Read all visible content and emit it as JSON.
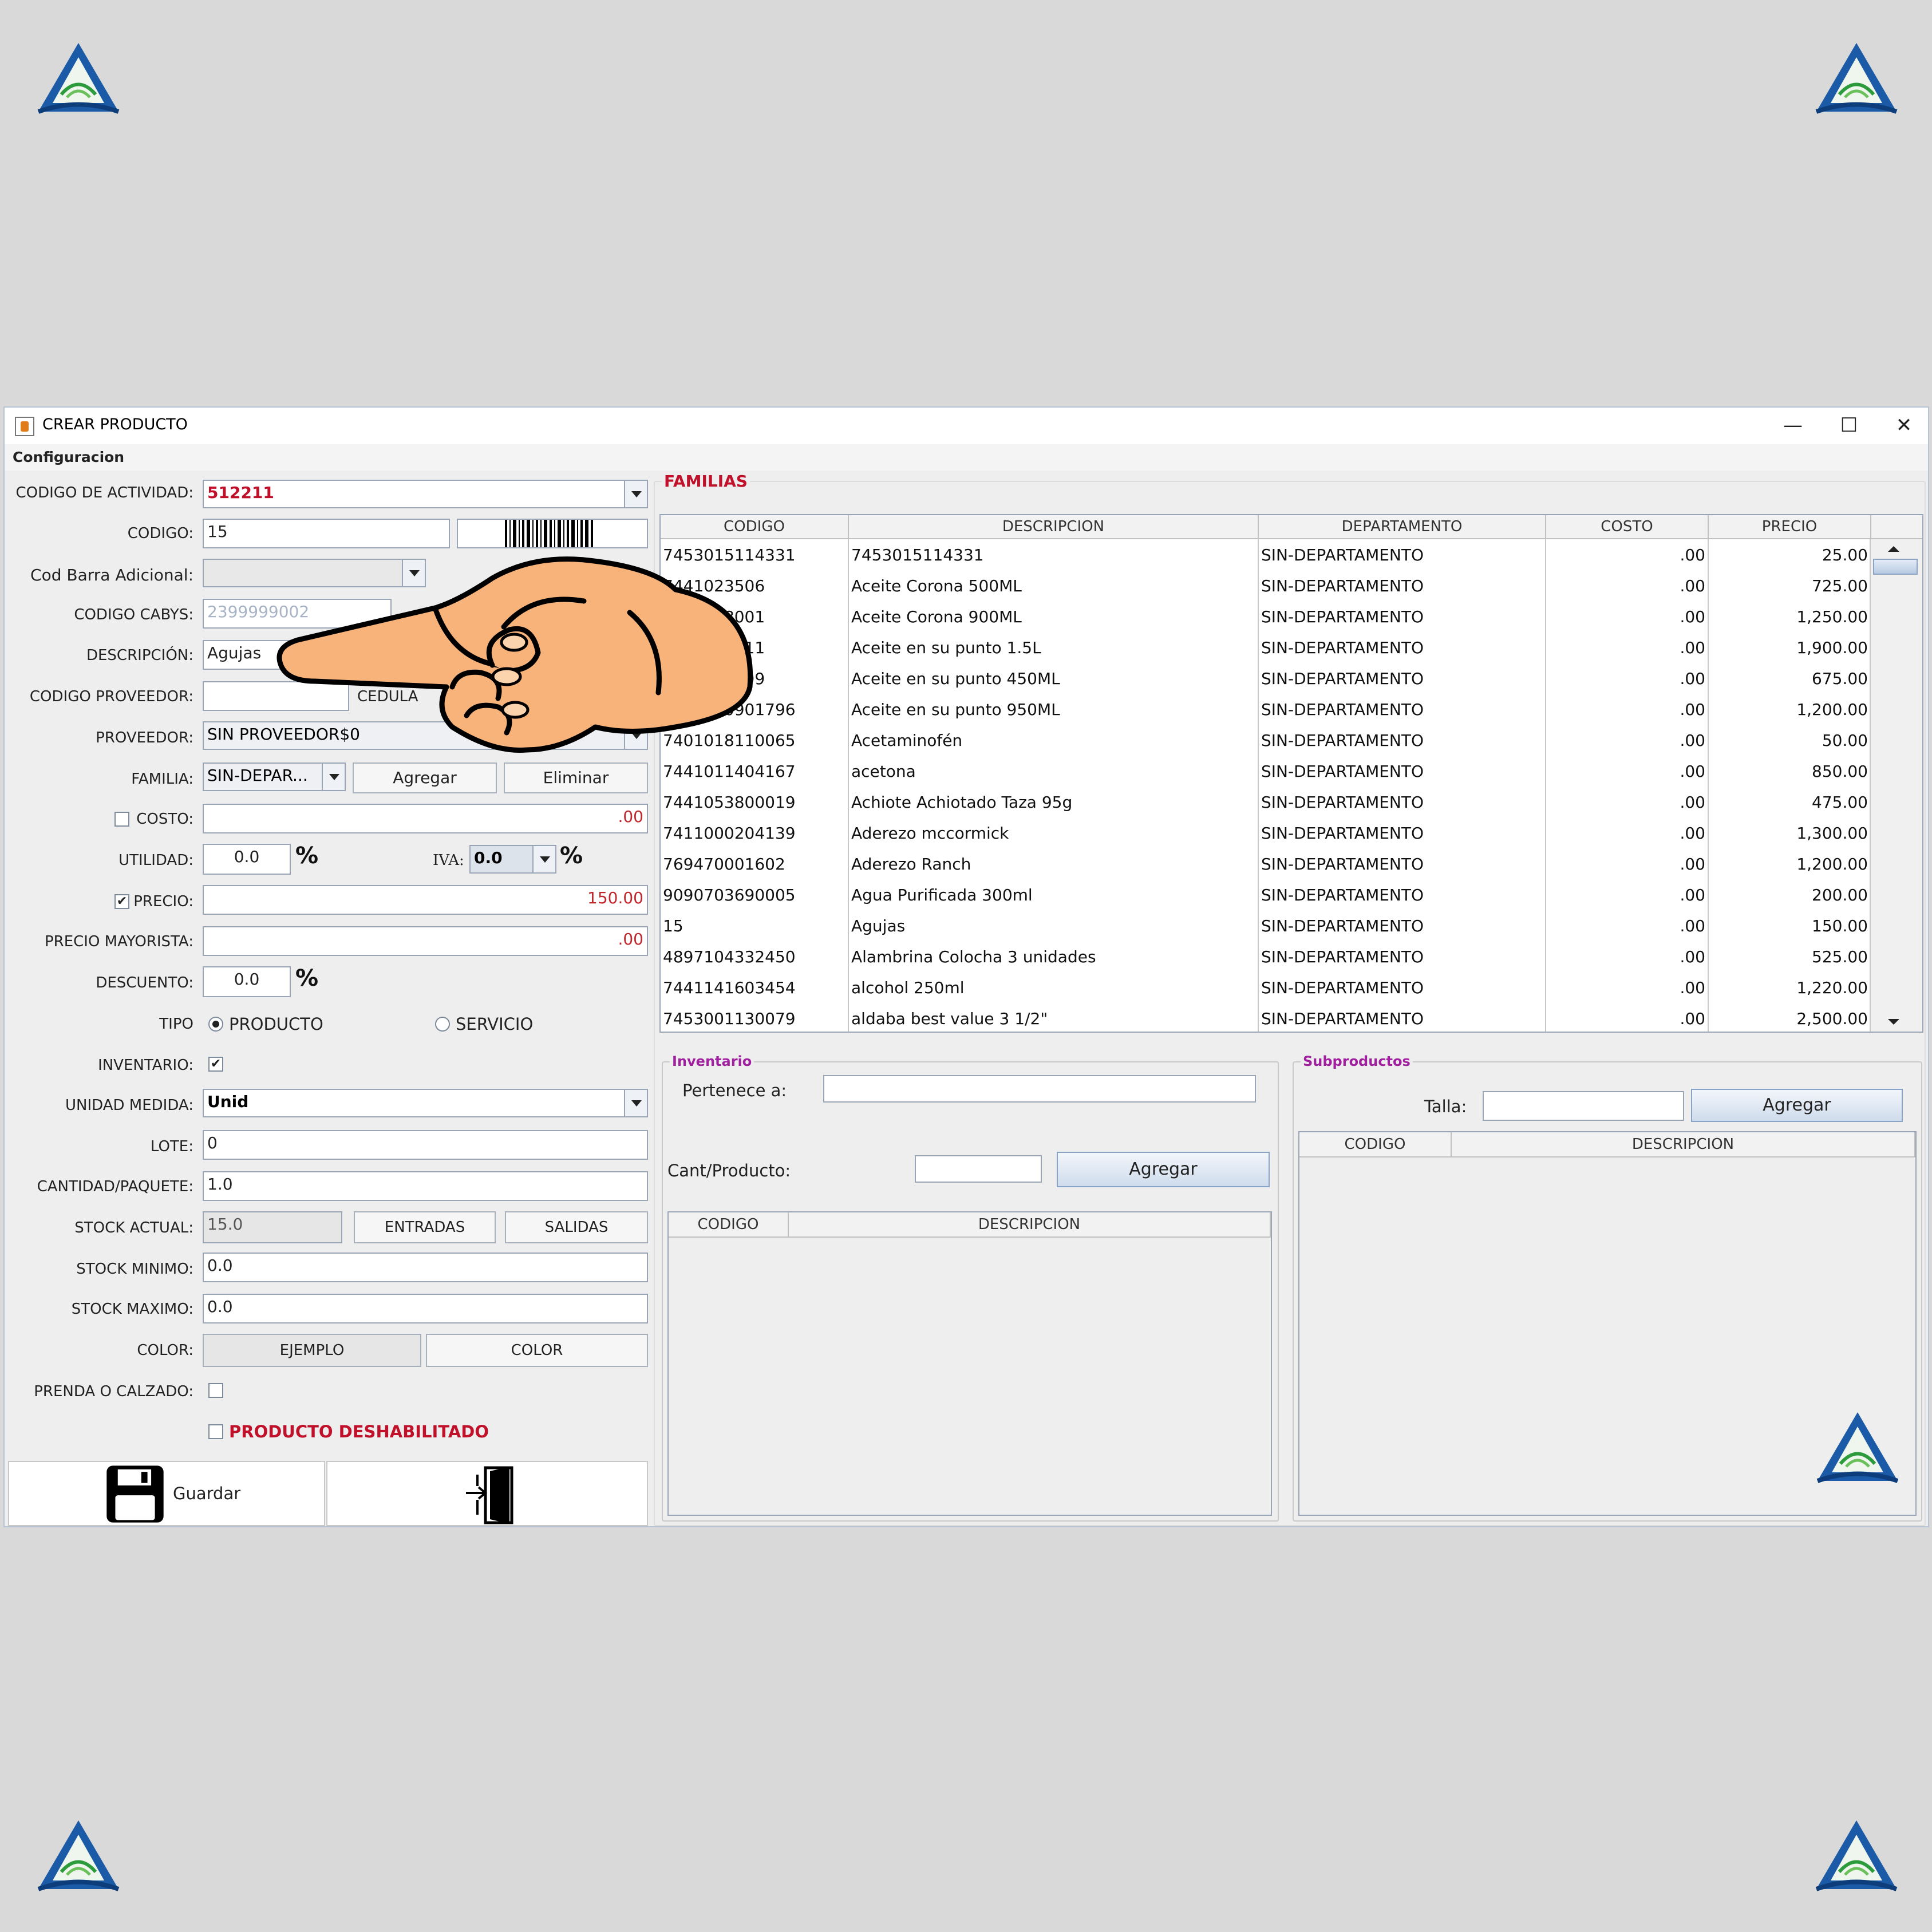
{
  "window": {
    "title": "CREAR PRODUCTO",
    "menu": "Configuracion"
  },
  "form": {
    "codigo_actividad": {
      "label": "CODIGO DE ACTIVIDAD:",
      "value": "512211"
    },
    "codigo": {
      "label": "CODIGO:",
      "value": "15"
    },
    "cod_barra_adicional": {
      "label": "Cod Barra Adicional:",
      "value": ""
    },
    "codigo_cabys": {
      "label": "CODIGO CABYS:",
      "value": "2399999002"
    },
    "descripcion": {
      "label": "DESCRIPCIÓN:",
      "value": "Agujas"
    },
    "codigo_proveedor": {
      "label": "CODIGO PROVEEDOR:",
      "value": "",
      "cedula_label": "CEDULA"
    },
    "proveedor": {
      "label": "PROVEEDOR:",
      "value": "SIN PROVEEDOR$0"
    },
    "familia": {
      "label": "FAMILIA:",
      "value": "SIN-DEPAR...",
      "agregar": "Agregar",
      "eliminar": "Eliminar"
    },
    "costo": {
      "label": "COSTO:",
      "value": ".00",
      "checked": false
    },
    "utilidad": {
      "label": "UTILIDAD:",
      "value": "0.0",
      "pct": "%"
    },
    "iva": {
      "label": "IVA:",
      "value": "0.0",
      "pct": "%"
    },
    "precio": {
      "label": "PRECIO:",
      "value": "150.00",
      "checked": true
    },
    "precio_mayorista": {
      "label": "PRECIO MAYORISTA:",
      "value": ".00"
    },
    "descuento": {
      "label": "DESCUENTO:",
      "value": "0.0",
      "pct": "%"
    },
    "tipo": {
      "label": "TIPO",
      "producto": "PRODUCTO",
      "servicio": "SERVICIO",
      "selected": "PRODUCTO"
    },
    "inventario": {
      "label": "INVENTARIO:",
      "checked": true
    },
    "unidad_medida": {
      "label": "UNIDAD MEDIDA:",
      "value": "Unid"
    },
    "lote": {
      "label": "LOTE:",
      "value": "0"
    },
    "cantidad_paquete": {
      "label": "CANTIDAD/PAQUETE:",
      "value": "1.0"
    },
    "stock_actual": {
      "label": "STOCK ACTUAL:",
      "value": "15.0",
      "entradas": "ENTRADAS",
      "salidas": "SALIDAS"
    },
    "stock_minimo": {
      "label": "STOCK MINIMO:",
      "value": "0.0"
    },
    "stock_maximo": {
      "label": "STOCK MAXIMO:",
      "value": "0.0"
    },
    "color": {
      "label": "COLOR:",
      "ejemplo": "EJEMPLO",
      "button": "COLOR"
    },
    "prenda_calzado": {
      "label": "PRENDA O CALZADO:",
      "checked": false
    },
    "deshabilitado": {
      "label": "PRODUCTO DESHABILITADO",
      "checked": false
    },
    "guardar": "Guardar"
  },
  "familias": {
    "title": "FAMILIAS",
    "columns": [
      "CODIGO",
      "DESCRIPCION",
      "DEPARTAMENTO",
      "COSTO",
      "PRECIO"
    ],
    "rows": [
      [
        "7453015114331",
        "7453015114331",
        "SIN-DEPARTAMENTO",
        ".00",
        "25.00"
      ],
      [
        "7441023506",
        "Aceite Corona 500ML",
        "SIN-DEPARTAMENTO",
        ".00",
        "725.00"
      ],
      [
        "7441028001",
        "Aceite Corona 900ML",
        "SIN-DEPARTAMENTO",
        ".00",
        "1,250.00"
      ],
      [
        "7441080911",
        "Aceite en su punto 1.5L",
        "SIN-DEPARTAMENTO",
        ".00",
        "1,900.00"
      ],
      [
        "7441080799",
        "Aceite en su punto 450ML",
        "SIN-DEPARTAMENTO",
        ".00",
        "675.00"
      ],
      [
        "7441080901796",
        "Aceite en su punto 950ML",
        "SIN-DEPARTAMENTO",
        ".00",
        "1,200.00"
      ],
      [
        "7401018110065",
        "Acetaminofén",
        "SIN-DEPARTAMENTO",
        ".00",
        "50.00"
      ],
      [
        "7441011404167",
        "acetona",
        "SIN-DEPARTAMENTO",
        ".00",
        "850.00"
      ],
      [
        "7441053800019",
        "Achiote Achiotado Taza 95g",
        "SIN-DEPARTAMENTO",
        ".00",
        "475.00"
      ],
      [
        "7411000204139",
        "Aderezo mccormick",
        "SIN-DEPARTAMENTO",
        ".00",
        "1,300.00"
      ],
      [
        "769470001602",
        "Aderezo Ranch",
        "SIN-DEPARTAMENTO",
        ".00",
        "1,200.00"
      ],
      [
        "9090703690005",
        "Agua Purificada 300ml",
        "SIN-DEPARTAMENTO",
        ".00",
        "200.00"
      ],
      [
        "15",
        "Agujas",
        "SIN-DEPARTAMENTO",
        ".00",
        "150.00"
      ],
      [
        "4897104332450",
        "Alambrina Colocha 3 unidades",
        "SIN-DEPARTAMENTO",
        ".00",
        "525.00"
      ],
      [
        "7441141603454",
        "alcohol 250ml",
        "SIN-DEPARTAMENTO",
        ".00",
        "1,220.00"
      ],
      [
        "7453001130079",
        "aldaba best value 3 1/2\"",
        "SIN-DEPARTAMENTO",
        ".00",
        "2,500.00"
      ]
    ]
  },
  "inventario": {
    "title": "Inventario",
    "pertenece_label": "Pertenece a:",
    "cant_label": "Cant/Producto:",
    "agregar": "Agregar",
    "columns": [
      "CODIGO",
      "DESCRIPCION"
    ]
  },
  "subproductos": {
    "title": "Subproductos",
    "talla_label": "Talla:",
    "agregar": "Agregar",
    "columns": [
      "CODIGO",
      "DESCRIPCION"
    ]
  },
  "icons": {
    "logo": "triangle-logo-icon",
    "pointer": "pointing-hand-icon",
    "save": "floppy-disk-icon",
    "exit": "exit-door-icon",
    "barcode": "barcode-icon"
  }
}
